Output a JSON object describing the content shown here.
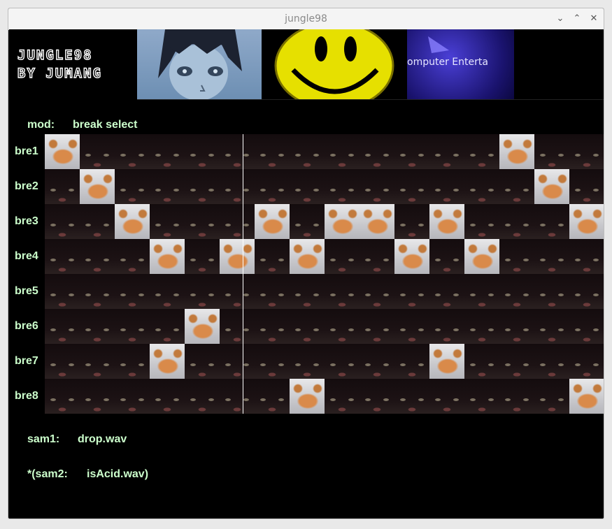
{
  "window": {
    "title": "jungle98",
    "controls": {
      "minimize": "⌄",
      "maximize": "⌃",
      "close": "✕"
    }
  },
  "header": {
    "logo_line1": "JUNGLE98",
    "logo_line2": "BY JUMANG",
    "banner3_text": "omputer Enterta"
  },
  "mod": {
    "label": "mod:",
    "value": "break select"
  },
  "rows": [
    {
      "label": "bre1",
      "steps": [
        1,
        0,
        0,
        0,
        0,
        0,
        0,
        0,
        0,
        0,
        0,
        0,
        0,
        1,
        0,
        0
      ]
    },
    {
      "label": "bre2",
      "steps": [
        0,
        1,
        0,
        0,
        0,
        0,
        0,
        0,
        0,
        0,
        0,
        0,
        0,
        0,
        1,
        0
      ]
    },
    {
      "label": "bre3",
      "steps": [
        0,
        0,
        1,
        0,
        0,
        0,
        1,
        0,
        1,
        1,
        0,
        1,
        0,
        0,
        0,
        1
      ]
    },
    {
      "label": "bre4",
      "steps": [
        0,
        0,
        0,
        1,
        0,
        1,
        0,
        1,
        0,
        0,
        1,
        0,
        1,
        0,
        0,
        0
      ]
    },
    {
      "label": "bre5",
      "steps": [
        0,
        0,
        0,
        0,
        0,
        0,
        0,
        0,
        0,
        0,
        0,
        0,
        0,
        0,
        0,
        0
      ]
    },
    {
      "label": "bre6",
      "steps": [
        0,
        0,
        0,
        0,
        1,
        0,
        0,
        0,
        0,
        0,
        0,
        0,
        0,
        0,
        0,
        0
      ]
    },
    {
      "label": "bre7",
      "steps": [
        0,
        0,
        0,
        1,
        0,
        0,
        0,
        0,
        0,
        0,
        0,
        1,
        0,
        0,
        0,
        0
      ]
    },
    {
      "label": "bre8",
      "steps": [
        0,
        0,
        0,
        0,
        0,
        0,
        0,
        1,
        0,
        0,
        0,
        0,
        0,
        0,
        0,
        1
      ]
    }
  ],
  "playhead_step": 6,
  "sam1": {
    "label": "sam1:",
    "value": "drop.wav"
  },
  "sam2": {
    "label": "*(sam2:",
    "value": "isAcid.wav)"
  }
}
